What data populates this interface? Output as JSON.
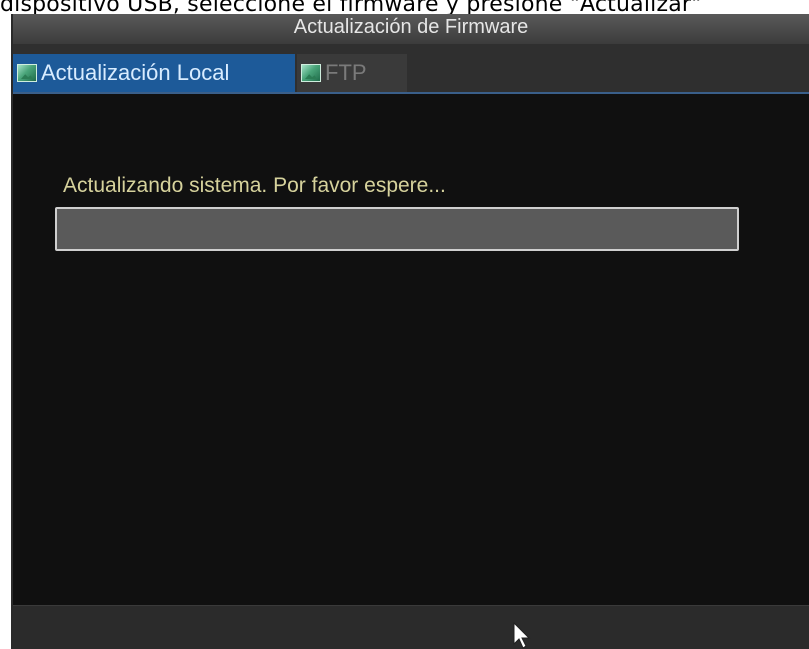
{
  "caption": "dispositivo USB, seleccione el firmware y presione \"Actualizar\"",
  "window": {
    "title": "Actualización de Firmware"
  },
  "tabs": [
    {
      "label": "Actualización Local",
      "icon": "image-icon",
      "active": true
    },
    {
      "label": "FTP",
      "icon": "image-icon",
      "active": false
    }
  ],
  "status": {
    "message": "Actualizando sistema. Por favor espere..."
  },
  "progress": {
    "fraction": 0.0
  },
  "colors": {
    "active_tab": "#1d5a99",
    "status_text": "#d6d29c",
    "window_bg": "#101010"
  }
}
